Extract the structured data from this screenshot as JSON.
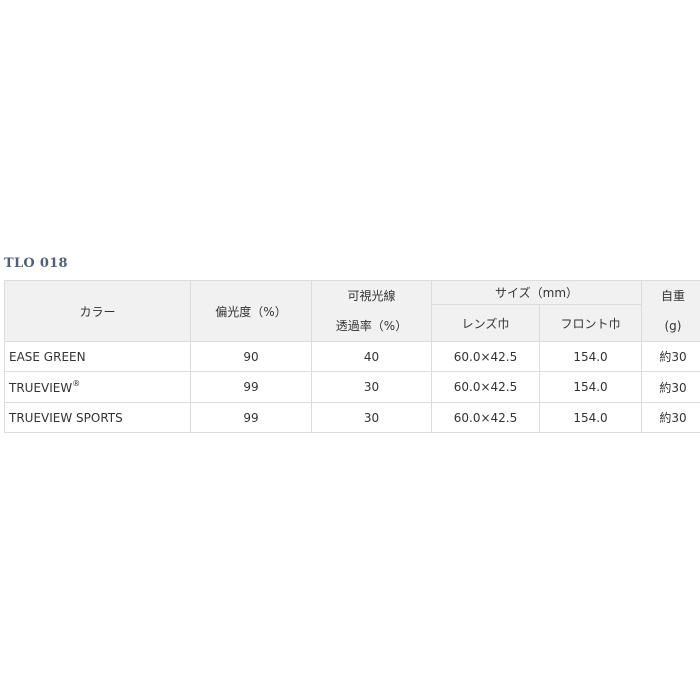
{
  "product": {
    "title": "TLO 018"
  },
  "headers": {
    "color": "カラー",
    "polarization": "偏光度（%）",
    "visible_light_line1": "可視光線",
    "visible_light_line2": "透過率（%）",
    "size": "サイズ（mm）",
    "lens_width": "レンズ巾",
    "front_width": "フロント巾",
    "weight_line1": "自重",
    "weight_line2": "(g)"
  },
  "rows": [
    {
      "name": "EASE GREEN",
      "sup": "",
      "polarization": "90",
      "transmittance": "40",
      "lens": "60.0×42.5",
      "front": "154.0",
      "weight": "約30"
    },
    {
      "name": "TRUEVIEW",
      "sup": "®",
      "polarization": "99",
      "transmittance": "30",
      "lens": "60.0×42.5",
      "front": "154.0",
      "weight": "約30"
    },
    {
      "name": "TRUEVIEW SPORTS",
      "sup": "",
      "polarization": "99",
      "transmittance": "30",
      "lens": "60.0×42.5",
      "front": "154.0",
      "weight": "約30"
    }
  ]
}
